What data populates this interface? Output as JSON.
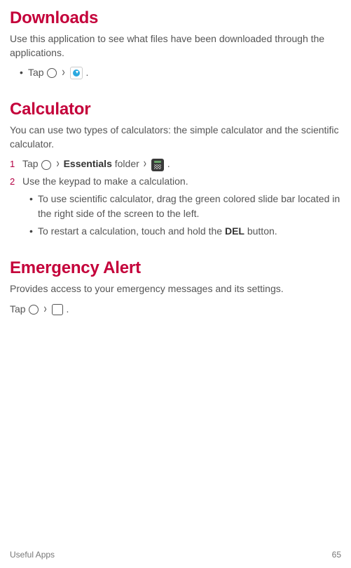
{
  "sections": {
    "downloads": {
      "title": "Downloads",
      "desc": "Use this application to see what files have been downloaded through the applications.",
      "tap_prefix": "Tap ",
      "period": "."
    },
    "calculator": {
      "title": "Calculator",
      "desc": "You can use two types of calculators: the simple calculator and the scientific calculator.",
      "steps": {
        "s1_num": "1",
        "s1_a": "Tap ",
        "s1_b": "Essentials",
        "s1_c": " folder ",
        "s1_period": ".",
        "s2_num": "2",
        "s2": "Use the keypad to make a calculation."
      },
      "sub": {
        "b1": "To use scientific calculator, drag the green colored slide bar located in the right side of the screen to the left.",
        "b2_a": "To restart a calculation, touch and hold the ",
        "b2_del": "DEL",
        "b2_b": " button."
      }
    },
    "emergency": {
      "title": "Emergency Alert",
      "desc": "Provides access to your emergency messages and its settings.",
      "tap_prefix": "Tap ",
      "period": "."
    }
  },
  "glyphs": {
    "bullet": "•",
    "chevron": "›"
  },
  "footer": {
    "left": "Useful Apps",
    "right": "65"
  }
}
